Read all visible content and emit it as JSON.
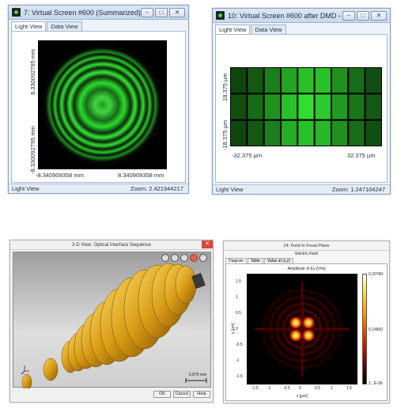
{
  "window1": {
    "title": "7: Virtual Screen #600 (Summarized) (Class...",
    "tabs": [
      "Light View",
      "Data View"
    ],
    "y_top_label": "8.330092795 mm",
    "y_bottom_label": "-8.330092795 mm",
    "x_left_label": "-8.340909358 mm",
    "x_right_label": "8.340909358 mm",
    "status_left": "Light View",
    "status_right": "Zoom: 2.421944217",
    "ring_color": "#2bd62b"
  },
  "window2": {
    "title": "10: Virtual Screen #600 after DMD - Modul...",
    "tabs": [
      "Light View",
      "Data View"
    ],
    "y_top_label": "18.375 µm",
    "y_bottom_label": "-18.375 µm",
    "x_left_label": "-32.375 µm",
    "x_right_label": "32.375 µm",
    "status_left": "Light View",
    "status_right": "Zoom: 1.247104247",
    "grid_levels": [
      [
        0.15,
        0.25,
        0.45,
        0.65,
        0.8,
        0.8,
        0.55,
        0.35,
        0.2
      ],
      [
        0.2,
        0.35,
        0.55,
        0.8,
        0.95,
        0.85,
        0.6,
        0.4,
        0.25
      ],
      [
        0.15,
        0.25,
        0.45,
        0.7,
        0.8,
        0.75,
        0.55,
        0.35,
        0.2
      ]
    ]
  },
  "window3": {
    "title": "3-D View: Optical Interface Sequence",
    "scale_label": "5.875 mm",
    "buttons": [
      "OK",
      "Cancel",
      "Help"
    ],
    "lens_color": "#e0a41e"
  },
  "window4": {
    "title": "24: Field In Focal Plane",
    "subtitle": "Electric Field",
    "tabs": [
      "Diagram",
      "Table",
      "Value at (x,y)"
    ],
    "plot_title": "Amplitude of Ey [V/m]",
    "colorbar_max": "0.29784",
    "colorbar_mid": "0.14892",
    "colorbar_min": "1...E-09",
    "y_axis_label": "y [µm]",
    "x_axis_label": "x [µm]",
    "x_ticks": [
      "-1.5",
      "-1",
      "-0.5",
      "0",
      "0.5",
      "1",
      "1.5"
    ],
    "y_ticks": [
      "1.5",
      "1",
      "0.5",
      "0",
      "-0.5",
      "-1",
      "-1.5"
    ]
  }
}
